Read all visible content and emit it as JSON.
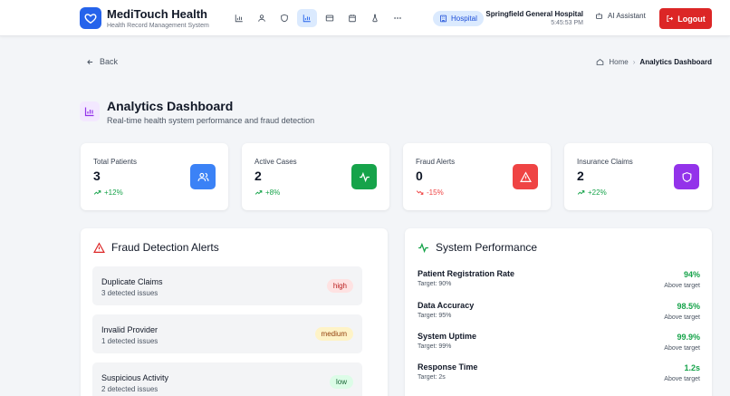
{
  "header": {
    "app_title": "MediTouch Health",
    "app_subtitle": "Health Record Management System",
    "nav_icons": [
      "bar-chart-icon",
      "user-icon",
      "shield-icon",
      "analytics-icon",
      "card-icon",
      "calendar-icon",
      "flask-icon",
      "more-icon"
    ],
    "active_nav": "analytics-icon",
    "hospital_badge": "Hospital",
    "hospital_name": "Springfield General Hospital",
    "time": "5:45:53 PM",
    "ai_assistant": "AI Assistant",
    "logout": "Logout"
  },
  "subbar": {
    "back": "Back",
    "breadcrumb_home": "Home",
    "breadcrumb_current": "Analytics Dashboard"
  },
  "page": {
    "title": "Analytics Dashboard",
    "subtitle": "Real-time health system performance and fraud detection"
  },
  "stats": [
    {
      "label": "Total Patients",
      "value": "3",
      "change": "+12%",
      "trend": "up",
      "icon": "users-icon",
      "color": "#3b82f6"
    },
    {
      "label": "Active Cases",
      "value": "2",
      "change": "+8%",
      "trend": "up",
      "icon": "activity-icon",
      "color": "#16a34a"
    },
    {
      "label": "Fraud Alerts",
      "value": "0",
      "change": "-15%",
      "trend": "down",
      "icon": "warning-icon",
      "color": "#ef4444"
    },
    {
      "label": "Insurance Claims",
      "value": "2",
      "change": "+22%",
      "trend": "up",
      "icon": "shield-icon",
      "color": "#9333ea"
    }
  ],
  "fraud": {
    "title": "Fraud Detection Alerts",
    "items": [
      {
        "name": "Duplicate Claims",
        "count": "3 detected issues",
        "severity": "high"
      },
      {
        "name": "Invalid Provider",
        "count": "1 detected issues",
        "severity": "medium"
      },
      {
        "name": "Suspicious Activity",
        "count": "2 detected issues",
        "severity": "low"
      }
    ]
  },
  "performance": {
    "title": "System Performance",
    "metrics": [
      {
        "name": "Patient Registration Rate",
        "target": "Target: 90%",
        "value": "94%",
        "note": "Above target"
      },
      {
        "name": "Data Accuracy",
        "target": "Target: 95%",
        "value": "98.5%",
        "note": "Above target"
      },
      {
        "name": "System Uptime",
        "target": "Target: 99%",
        "value": "99.9%",
        "note": "Above target"
      },
      {
        "name": "Response Time",
        "target": "Target: 2s",
        "value": "1.2s",
        "note": "Above target"
      }
    ]
  },
  "colors": {
    "primary": "#2563eb",
    "danger": "#dc2626",
    "success": "#16a34a",
    "purple": "#9333ea"
  }
}
